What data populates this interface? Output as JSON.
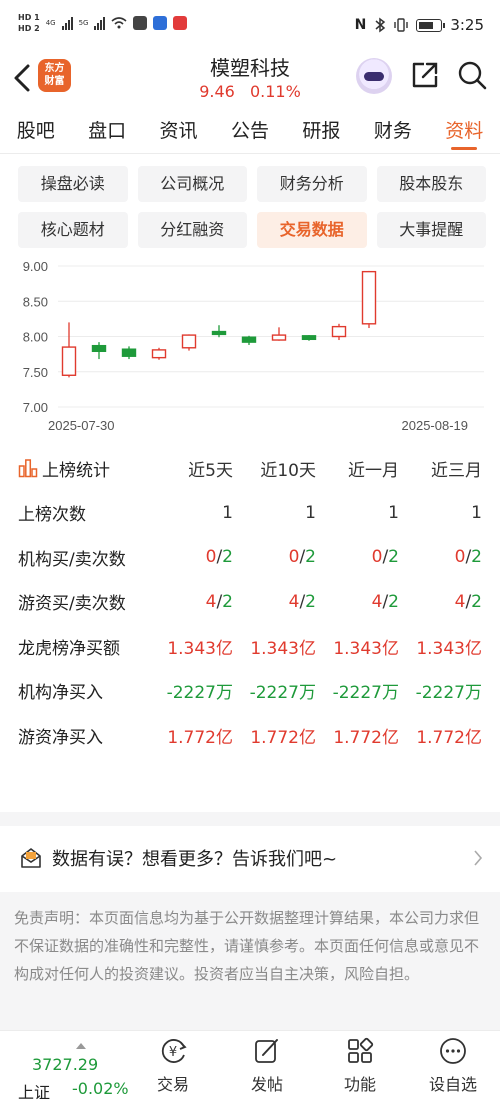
{
  "status": {
    "left_tags": [
      "HD 1",
      "HD 2"
    ],
    "net1": "4G",
    "net2": "5G",
    "time": "3:25"
  },
  "header": {
    "logo_line1": "东方",
    "logo_line2": "财富",
    "title": "模塑科技",
    "price": "9.46",
    "change_pct": "0.11%"
  },
  "tabs": [
    "股吧",
    "盘口",
    "资讯",
    "公告",
    "研报",
    "财务",
    "资料"
  ],
  "active_tab_index": 6,
  "sub_buttons": [
    "操盘必读",
    "公司概况",
    "财务分析",
    "股本股东",
    "核心题材",
    "分红融资",
    "交易数据",
    "大事提醒"
  ],
  "active_sub_index": 6,
  "chart_data": {
    "type": "candlestick",
    "x_start_label": "2025-07-30",
    "x_end_label": "2025-08-19",
    "y_ticks": [
      "9.00",
      "8.50",
      "8.00",
      "7.50",
      "7.00"
    ],
    "ylim": [
      7.0,
      9.0
    ],
    "candles": [
      {
        "open": 7.45,
        "close": 7.85,
        "high": 8.2,
        "low": 7.42,
        "up": true
      },
      {
        "open": 7.87,
        "close": 7.79,
        "high": 7.92,
        "low": 7.68,
        "up": false
      },
      {
        "open": 7.82,
        "close": 7.72,
        "high": 7.86,
        "low": 7.68,
        "up": false
      },
      {
        "open": 7.7,
        "close": 7.81,
        "high": 7.84,
        "low": 7.67,
        "up": true
      },
      {
        "open": 7.84,
        "close": 8.02,
        "high": 8.03,
        "low": 7.8,
        "up": true
      },
      {
        "open": 8.07,
        "close": 8.03,
        "high": 8.16,
        "low": 7.99,
        "up": false
      },
      {
        "open": 7.99,
        "close": 7.92,
        "high": 8.01,
        "low": 7.88,
        "up": false
      },
      {
        "open": 7.95,
        "close": 8.02,
        "high": 8.13,
        "low": 7.94,
        "up": true
      },
      {
        "open": 8.01,
        "close": 7.96,
        "high": 8.02,
        "low": 7.94,
        "up": false
      },
      {
        "open": 8.0,
        "close": 8.14,
        "high": 8.18,
        "low": 7.95,
        "up": true
      },
      {
        "open": 8.18,
        "close": 8.92,
        "high": 8.93,
        "low": 8.12,
        "up": true
      }
    ],
    "up_color": "#e03a2e",
    "down_color": "#1e9a3a"
  },
  "stats": {
    "header_label": "上榜统计",
    "columns": [
      "近5天",
      "近10天",
      "近一月",
      "近三月"
    ],
    "rows": [
      {
        "label": "上榜次数",
        "type": "plain",
        "values": [
          "1",
          "1",
          "1",
          "1"
        ]
      },
      {
        "label": "机构买/卖次数",
        "type": "split",
        "values": [
          [
            "0",
            "/",
            "2"
          ],
          [
            "0",
            "/",
            "2"
          ],
          [
            "0",
            "/",
            "2"
          ],
          [
            "0",
            "/",
            "2"
          ]
        ]
      },
      {
        "label": "游资买/卖次数",
        "type": "split",
        "values": [
          [
            "4",
            "/",
            "2"
          ],
          [
            "4",
            "/",
            "2"
          ],
          [
            "4",
            "/",
            "2"
          ],
          [
            "4",
            "/",
            "2"
          ]
        ]
      },
      {
        "label": "龙虎榜净买额",
        "type": "red",
        "values": [
          "1.343亿",
          "1.343亿",
          "1.343亿",
          "1.343亿"
        ]
      },
      {
        "label": "机构净买入",
        "type": "green",
        "values": [
          "-2227万",
          "-2227万",
          "-2227万",
          "-2227万"
        ]
      },
      {
        "label": "游资净买入",
        "type": "red",
        "values": [
          "1.772亿",
          "1.772亿",
          "1.772亿",
          "1.772亿"
        ]
      }
    ]
  },
  "feedback": {
    "text": "数据有误？想看更多？告诉我们吧~"
  },
  "disclaimer": "免责声明：本页面信息均为基于公开数据整理计算结果，本公司力求但不保证数据的准确性和完整性，请谨慎参考。本页面任何信息或意见不构成对任何人的投资建议。投资者应当自主决策，风险自担。",
  "bottom": {
    "index_value": "3727.29",
    "index_name": "上证",
    "index_change": "-0.02%",
    "nav": [
      "交易",
      "发帖",
      "功能",
      "设自选"
    ]
  }
}
